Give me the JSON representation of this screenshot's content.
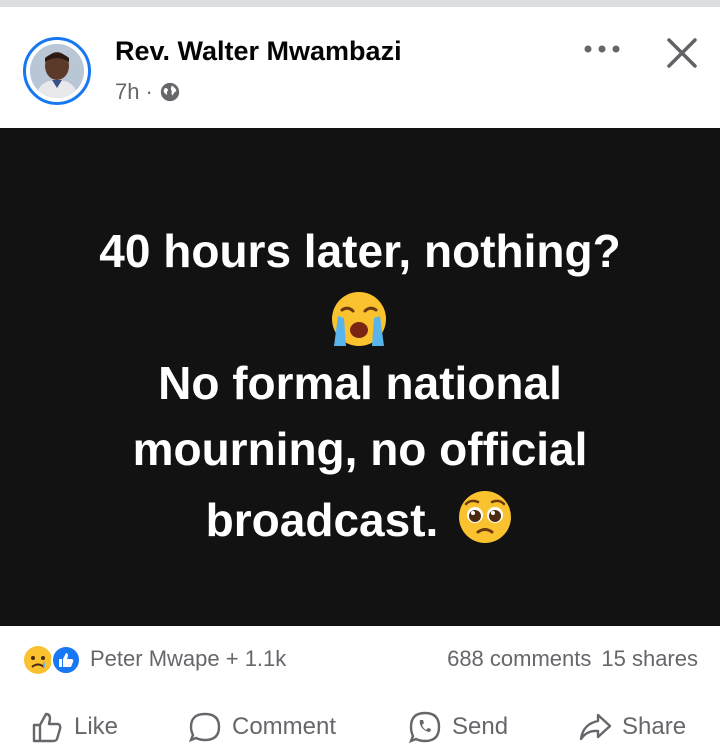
{
  "post": {
    "author": "Rev. Walter Mwambazi",
    "time": "7h",
    "separator": "·",
    "image_text": {
      "line1": "40 hours later, nothing?",
      "line3": "No formal national",
      "line4": "mourning, no official",
      "line5": "broadcast."
    }
  },
  "stats": {
    "reactors": "Peter Mwape + 1.1k",
    "comments": "688 comments",
    "shares": "15 shares"
  },
  "actions": {
    "like": "Like",
    "comment": "Comment",
    "send": "Send",
    "share": "Share"
  },
  "icons": [
    "globe-icon",
    "more-options-icon",
    "close-icon",
    "crying-emoji",
    "pleading-emoji",
    "sad-reaction-icon",
    "like-reaction-icon",
    "like-icon",
    "comment-icon",
    "send-icon",
    "share-icon"
  ],
  "colors": {
    "brand_blue": "#1877f2",
    "image_background": "#121212",
    "secondary_text": "#65676b"
  }
}
